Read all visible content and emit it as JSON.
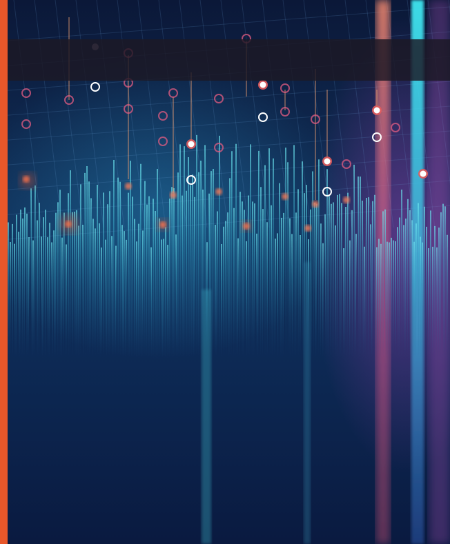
{
  "colors": {
    "accent": "#e8572a",
    "band": "#1c1824",
    "background_top": "#0b1838",
    "background_mid": "#10305a",
    "wave_cyan": "#4fd6e6",
    "marker_orange": "#f07a5a",
    "marker_pink": "#e35c82",
    "marker_white": "#ffffff",
    "light_streak_pink": "#e8708c",
    "light_streak_cyan": "#3fe6f0"
  }
}
